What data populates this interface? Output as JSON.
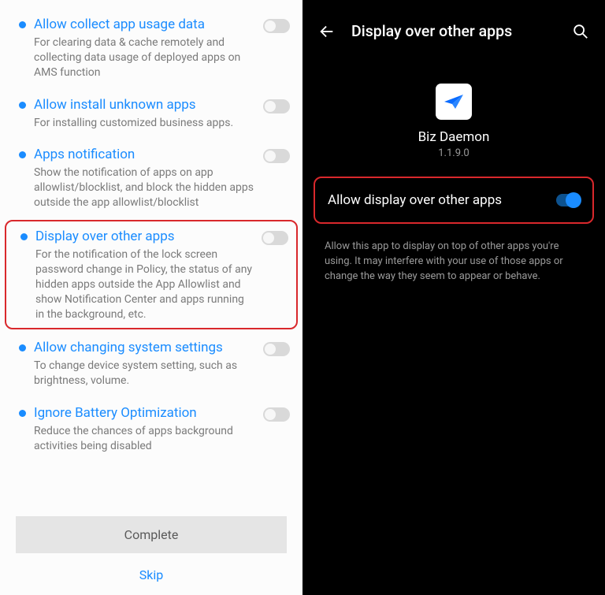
{
  "left": {
    "items": [
      {
        "title": "Allow collect app usage data",
        "desc": "For clearing data & cache remotely and collecting data usage of deployed apps on AMS function"
      },
      {
        "title": "Allow install unknown apps",
        "desc": "For installing customized business apps."
      },
      {
        "title": "Apps notification",
        "desc": "Show the notification of apps on app allowlist/blocklist, and block the hidden apps outside the app allowlist/blocklist"
      },
      {
        "title": "Display over other apps",
        "desc": "For the notification of the lock screen password change in Policy, the status of any hidden apps outside the App Allowlist and show Notification Center and apps running in the background, etc."
      },
      {
        "title": "Allow changing system settings",
        "desc": "To change device system setting, such as brightness, volume."
      },
      {
        "title": "Ignore Battery Optimization",
        "desc": "Reduce the chances of apps background activities being disabled"
      }
    ],
    "complete": "Complete",
    "skip": "Skip"
  },
  "right": {
    "title": "Display over other apps",
    "app_name": "Biz Daemon",
    "app_version": "1.1.9.0",
    "setting_label": "Allow display over other apps",
    "setting_desc": "Allow this app to display on top of other apps you're using. It may interfere with your use of those apps or change the way they seem to appear or behave."
  }
}
